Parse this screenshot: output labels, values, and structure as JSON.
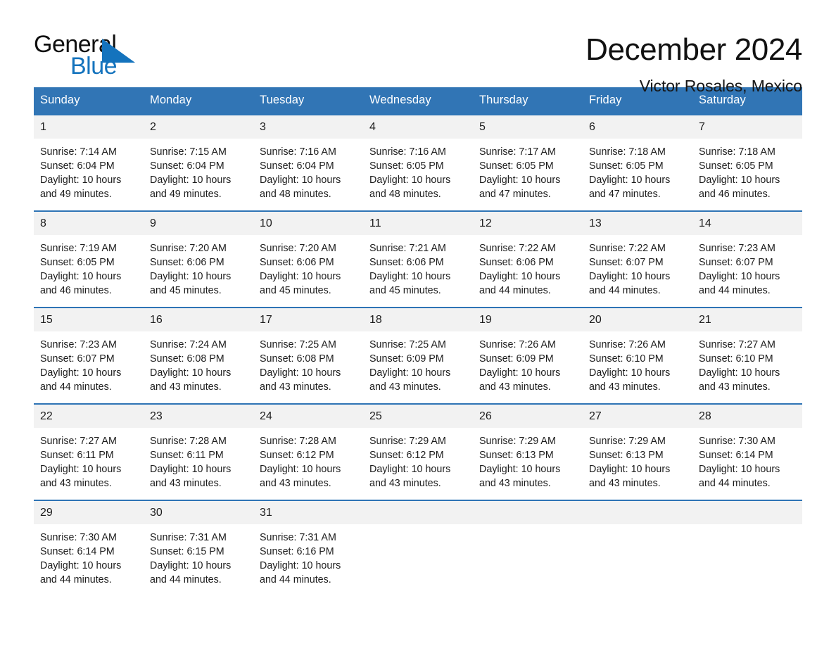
{
  "brand": {
    "name_part1": "General",
    "name_part2": "Blue",
    "triangle_color": "#1473bd",
    "icon": "general-blue-logo"
  },
  "header": {
    "title": "December 2024",
    "subtitle": "Victor Rosales, Mexico"
  },
  "theme": {
    "header_blue": "#3175b5",
    "rule_blue": "#2e74b5",
    "date_band_gray": "#f2f2f2",
    "text": "#1c1c1c"
  },
  "weekdays": [
    "Sunday",
    "Monday",
    "Tuesday",
    "Wednesday",
    "Thursday",
    "Friday",
    "Saturday"
  ],
  "weeks": [
    {
      "dates": [
        "1",
        "2",
        "3",
        "4",
        "5",
        "6",
        "7"
      ],
      "cells": [
        {
          "sunrise": "Sunrise: 7:14 AM",
          "sunset": "Sunset: 6:04 PM",
          "daylight1": "Daylight: 10 hours",
          "daylight2": "and 49 minutes."
        },
        {
          "sunrise": "Sunrise: 7:15 AM",
          "sunset": "Sunset: 6:04 PM",
          "daylight1": "Daylight: 10 hours",
          "daylight2": "and 49 minutes."
        },
        {
          "sunrise": "Sunrise: 7:16 AM",
          "sunset": "Sunset: 6:04 PM",
          "daylight1": "Daylight: 10 hours",
          "daylight2": "and 48 minutes."
        },
        {
          "sunrise": "Sunrise: 7:16 AM",
          "sunset": "Sunset: 6:05 PM",
          "daylight1": "Daylight: 10 hours",
          "daylight2": "and 48 minutes."
        },
        {
          "sunrise": "Sunrise: 7:17 AM",
          "sunset": "Sunset: 6:05 PM",
          "daylight1": "Daylight: 10 hours",
          "daylight2": "and 47 minutes."
        },
        {
          "sunrise": "Sunrise: 7:18 AM",
          "sunset": "Sunset: 6:05 PM",
          "daylight1": "Daylight: 10 hours",
          "daylight2": "and 47 minutes."
        },
        {
          "sunrise": "Sunrise: 7:18 AM",
          "sunset": "Sunset: 6:05 PM",
          "daylight1": "Daylight: 10 hours",
          "daylight2": "and 46 minutes."
        }
      ]
    },
    {
      "dates": [
        "8",
        "9",
        "10",
        "11",
        "12",
        "13",
        "14"
      ],
      "cells": [
        {
          "sunrise": "Sunrise: 7:19 AM",
          "sunset": "Sunset: 6:05 PM",
          "daylight1": "Daylight: 10 hours",
          "daylight2": "and 46 minutes."
        },
        {
          "sunrise": "Sunrise: 7:20 AM",
          "sunset": "Sunset: 6:06 PM",
          "daylight1": "Daylight: 10 hours",
          "daylight2": "and 45 minutes."
        },
        {
          "sunrise": "Sunrise: 7:20 AM",
          "sunset": "Sunset: 6:06 PM",
          "daylight1": "Daylight: 10 hours",
          "daylight2": "and 45 minutes."
        },
        {
          "sunrise": "Sunrise: 7:21 AM",
          "sunset": "Sunset: 6:06 PM",
          "daylight1": "Daylight: 10 hours",
          "daylight2": "and 45 minutes."
        },
        {
          "sunrise": "Sunrise: 7:22 AM",
          "sunset": "Sunset: 6:06 PM",
          "daylight1": "Daylight: 10 hours",
          "daylight2": "and 44 minutes."
        },
        {
          "sunrise": "Sunrise: 7:22 AM",
          "sunset": "Sunset: 6:07 PM",
          "daylight1": "Daylight: 10 hours",
          "daylight2": "and 44 minutes."
        },
        {
          "sunrise": "Sunrise: 7:23 AM",
          "sunset": "Sunset: 6:07 PM",
          "daylight1": "Daylight: 10 hours",
          "daylight2": "and 44 minutes."
        }
      ]
    },
    {
      "dates": [
        "15",
        "16",
        "17",
        "18",
        "19",
        "20",
        "21"
      ],
      "cells": [
        {
          "sunrise": "Sunrise: 7:23 AM",
          "sunset": "Sunset: 6:07 PM",
          "daylight1": "Daylight: 10 hours",
          "daylight2": "and 44 minutes."
        },
        {
          "sunrise": "Sunrise: 7:24 AM",
          "sunset": "Sunset: 6:08 PM",
          "daylight1": "Daylight: 10 hours",
          "daylight2": "and 43 minutes."
        },
        {
          "sunrise": "Sunrise: 7:25 AM",
          "sunset": "Sunset: 6:08 PM",
          "daylight1": "Daylight: 10 hours",
          "daylight2": "and 43 minutes."
        },
        {
          "sunrise": "Sunrise: 7:25 AM",
          "sunset": "Sunset: 6:09 PM",
          "daylight1": "Daylight: 10 hours",
          "daylight2": "and 43 minutes."
        },
        {
          "sunrise": "Sunrise: 7:26 AM",
          "sunset": "Sunset: 6:09 PM",
          "daylight1": "Daylight: 10 hours",
          "daylight2": "and 43 minutes."
        },
        {
          "sunrise": "Sunrise: 7:26 AM",
          "sunset": "Sunset: 6:10 PM",
          "daylight1": "Daylight: 10 hours",
          "daylight2": "and 43 minutes."
        },
        {
          "sunrise": "Sunrise: 7:27 AM",
          "sunset": "Sunset: 6:10 PM",
          "daylight1": "Daylight: 10 hours",
          "daylight2": "and 43 minutes."
        }
      ]
    },
    {
      "dates": [
        "22",
        "23",
        "24",
        "25",
        "26",
        "27",
        "28"
      ],
      "cells": [
        {
          "sunrise": "Sunrise: 7:27 AM",
          "sunset": "Sunset: 6:11 PM",
          "daylight1": "Daylight: 10 hours",
          "daylight2": "and 43 minutes."
        },
        {
          "sunrise": "Sunrise: 7:28 AM",
          "sunset": "Sunset: 6:11 PM",
          "daylight1": "Daylight: 10 hours",
          "daylight2": "and 43 minutes."
        },
        {
          "sunrise": "Sunrise: 7:28 AM",
          "sunset": "Sunset: 6:12 PM",
          "daylight1": "Daylight: 10 hours",
          "daylight2": "and 43 minutes."
        },
        {
          "sunrise": "Sunrise: 7:29 AM",
          "sunset": "Sunset: 6:12 PM",
          "daylight1": "Daylight: 10 hours",
          "daylight2": "and 43 minutes."
        },
        {
          "sunrise": "Sunrise: 7:29 AM",
          "sunset": "Sunset: 6:13 PM",
          "daylight1": "Daylight: 10 hours",
          "daylight2": "and 43 minutes."
        },
        {
          "sunrise": "Sunrise: 7:29 AM",
          "sunset": "Sunset: 6:13 PM",
          "daylight1": "Daylight: 10 hours",
          "daylight2": "and 43 minutes."
        },
        {
          "sunrise": "Sunrise: 7:30 AM",
          "sunset": "Sunset: 6:14 PM",
          "daylight1": "Daylight: 10 hours",
          "daylight2": "and 44 minutes."
        }
      ]
    },
    {
      "dates": [
        "29",
        "30",
        "31",
        "",
        "",
        "",
        ""
      ],
      "cells": [
        {
          "sunrise": "Sunrise: 7:30 AM",
          "sunset": "Sunset: 6:14 PM",
          "daylight1": "Daylight: 10 hours",
          "daylight2": "and 44 minutes."
        },
        {
          "sunrise": "Sunrise: 7:31 AM",
          "sunset": "Sunset: 6:15 PM",
          "daylight1": "Daylight: 10 hours",
          "daylight2": "and 44 minutes."
        },
        {
          "sunrise": "Sunrise: 7:31 AM",
          "sunset": "Sunset: 6:16 PM",
          "daylight1": "Daylight: 10 hours",
          "daylight2": "and 44 minutes."
        },
        {
          "sunrise": "",
          "sunset": "",
          "daylight1": "",
          "daylight2": ""
        },
        {
          "sunrise": "",
          "sunset": "",
          "daylight1": "",
          "daylight2": ""
        },
        {
          "sunrise": "",
          "sunset": "",
          "daylight1": "",
          "daylight2": ""
        },
        {
          "sunrise": "",
          "sunset": "",
          "daylight1": "",
          "daylight2": ""
        }
      ]
    }
  ]
}
